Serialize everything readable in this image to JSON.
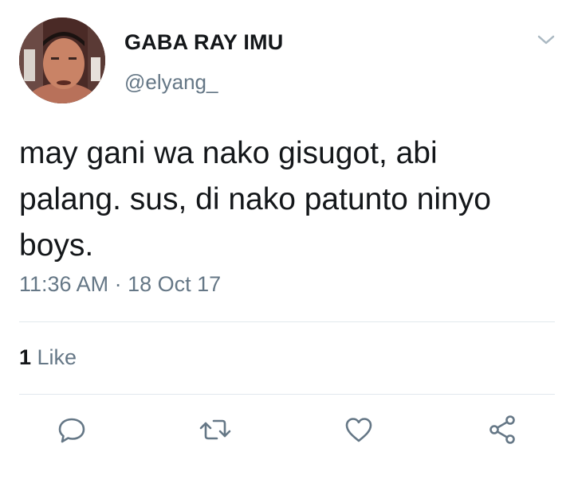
{
  "user": {
    "display_name": "GABA RAY IMU",
    "handle": "@elyang_",
    "avatar_icon": "profile-photo"
  },
  "tweet": {
    "text": "may gani wa nako gisugot, abi\npalang. sus, di nako patunto ninyo\nboys.",
    "timestamp": "11:36 AM · 18 Oct 17"
  },
  "stats": {
    "like_count": "1",
    "like_label": " Like"
  },
  "actions": {
    "reply_icon": "reply-icon",
    "retweet_icon": "retweet-icon",
    "like_icon": "heart-icon",
    "share_icon": "share-icon"
  },
  "colors": {
    "text_primary": "#14171a",
    "text_secondary": "#657786",
    "divider": "#e1e8ed",
    "icon": "#657786"
  }
}
